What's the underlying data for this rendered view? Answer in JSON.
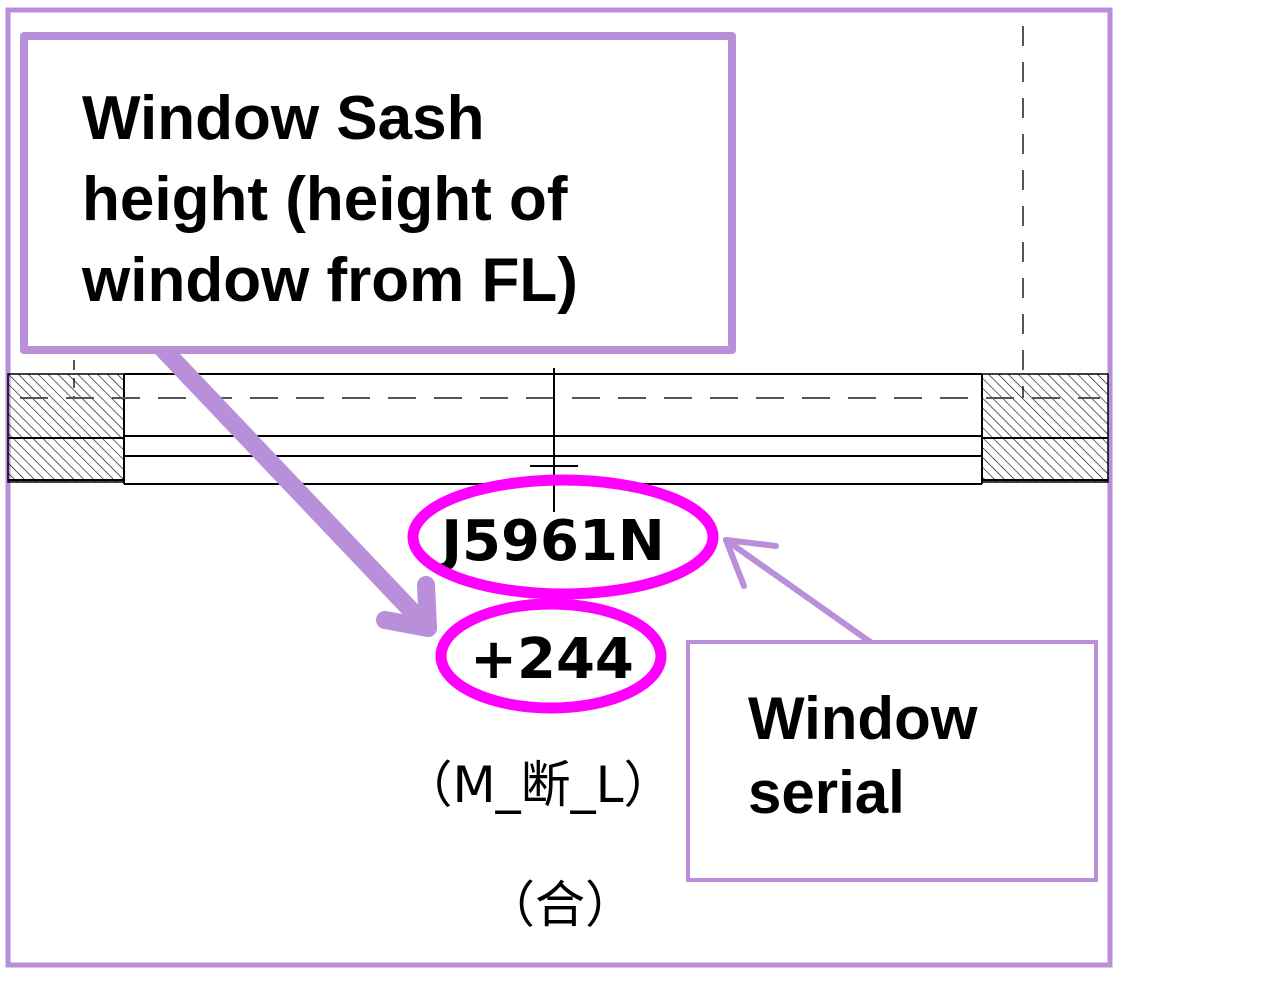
{
  "callouts": {
    "sash_height": {
      "text": "Window Sash\nheight (height of\nwindow from FL)"
    },
    "window_serial": {
      "text": "Window\nserial"
    }
  },
  "drawing": {
    "serial_code": "J5961N",
    "height_offset": "+244",
    "section_label": "（M_断_L）",
    "note_label": "（合）"
  },
  "colors": {
    "frame": "#b88fd8",
    "highlight": "#ff00ff",
    "drawing_line": "#000000",
    "dashed": "#555555"
  }
}
